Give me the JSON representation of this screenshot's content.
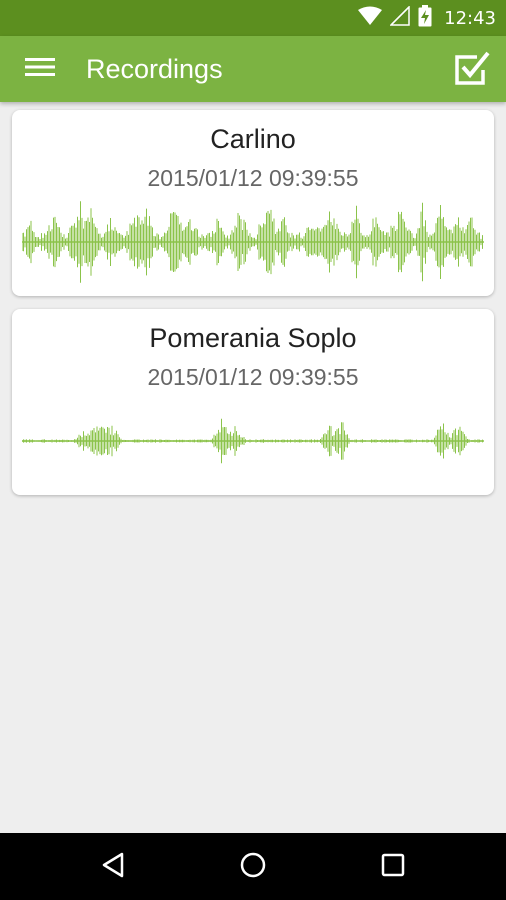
{
  "status_bar": {
    "time": "12:43"
  },
  "app_bar": {
    "title": "Recordings",
    "menu_icon": "hamburger-menu-icon",
    "select_icon": "checkbox-checked-icon"
  },
  "recordings": [
    {
      "name": "Carlino",
      "date": "2015/01/12 09:39:55"
    },
    {
      "name": "Pomerania Soplo",
      "date": "2015/01/12 09:39:55"
    }
  ],
  "nav_bar": {
    "back_icon": "back-triangle-icon",
    "home_icon": "home-circle-icon",
    "recents_icon": "recents-square-icon"
  },
  "colors": {
    "primary": "#7cb342",
    "primary_dark": "#5c8f1f",
    "waveform": "#8bc34a"
  }
}
